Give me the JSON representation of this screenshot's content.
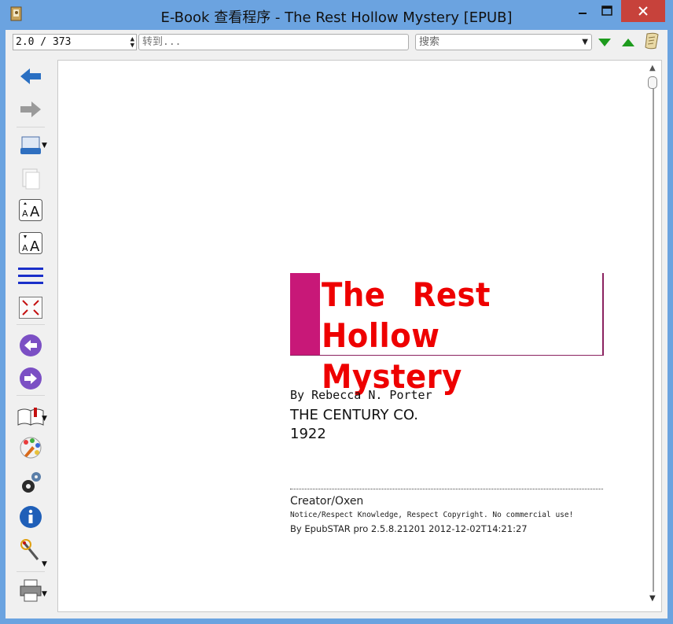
{
  "window": {
    "title": "E-Book 查看程序 - The Rest Hollow Mystery [EPUB]",
    "buttons": {
      "minimize": "minimize",
      "maximize": "maximize",
      "close": "close"
    }
  },
  "toolbar": {
    "page_position": "2.0 / 373",
    "goto_placeholder": "转到...",
    "search_placeholder": "搜索"
  },
  "colors": {
    "title_bar": "#6ba3e0",
    "close_button": "#c7423b",
    "book_title": "#ee0000",
    "title_accent": "#c81878"
  },
  "book": {
    "title": "The Rest Hollow Mystery",
    "author": "By Rebecca N. Porter",
    "publisher": "THE CENTURY CO.",
    "year": "1922",
    "creator": "Creator/Oxen",
    "notice": "Notice/Respect Knowledge, Respect Copyright. No commercial use!",
    "made_by": "By EpubSTAR pro 2.5.8.21201 2012-12-02T14:21:27"
  },
  "sidebar": {
    "icons": [
      "back-arrow-icon",
      "forward-arrow-icon",
      "library-icon",
      "copy-icon",
      "font-larger-icon",
      "font-smaller-icon",
      "line-spacing-icon",
      "fullscreen-icon",
      "previous-page-icon",
      "next-page-icon",
      "bookmarks-icon",
      "theme-icon",
      "settings-icon",
      "info-icon",
      "tools-icon",
      "print-icon"
    ]
  }
}
